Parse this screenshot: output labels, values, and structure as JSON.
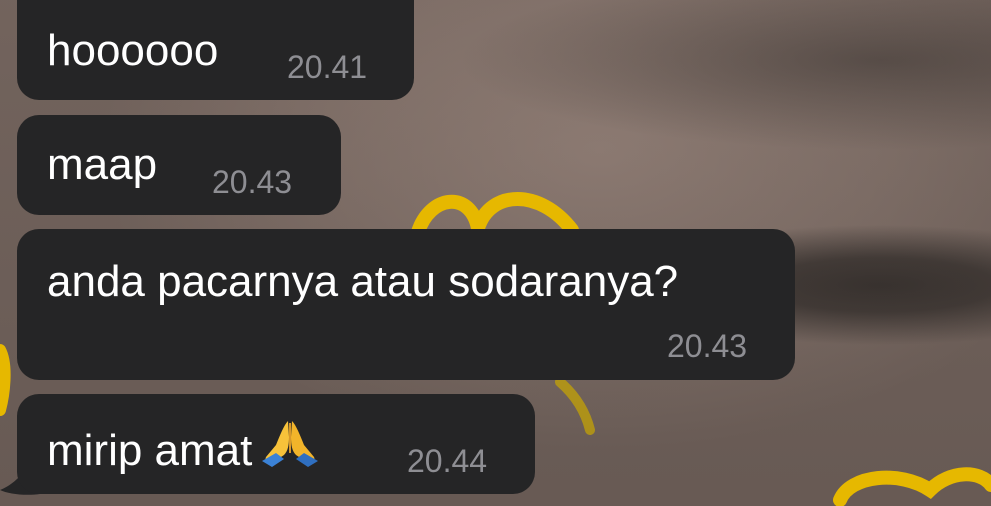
{
  "messages": [
    {
      "text": "hoooooo",
      "time": "20.41"
    },
    {
      "text": "maap",
      "time": "20.43"
    },
    {
      "text": "anda pacarnya atau sodaranya?",
      "time": "20.43"
    },
    {
      "text": "mirip amat",
      "emoji": "folded-hands",
      "time": "20.44"
    }
  ],
  "colors": {
    "bubble": "#252526",
    "text": "#ffffff",
    "timestamp": "#8e8e93",
    "doodle": "#e6b800"
  }
}
